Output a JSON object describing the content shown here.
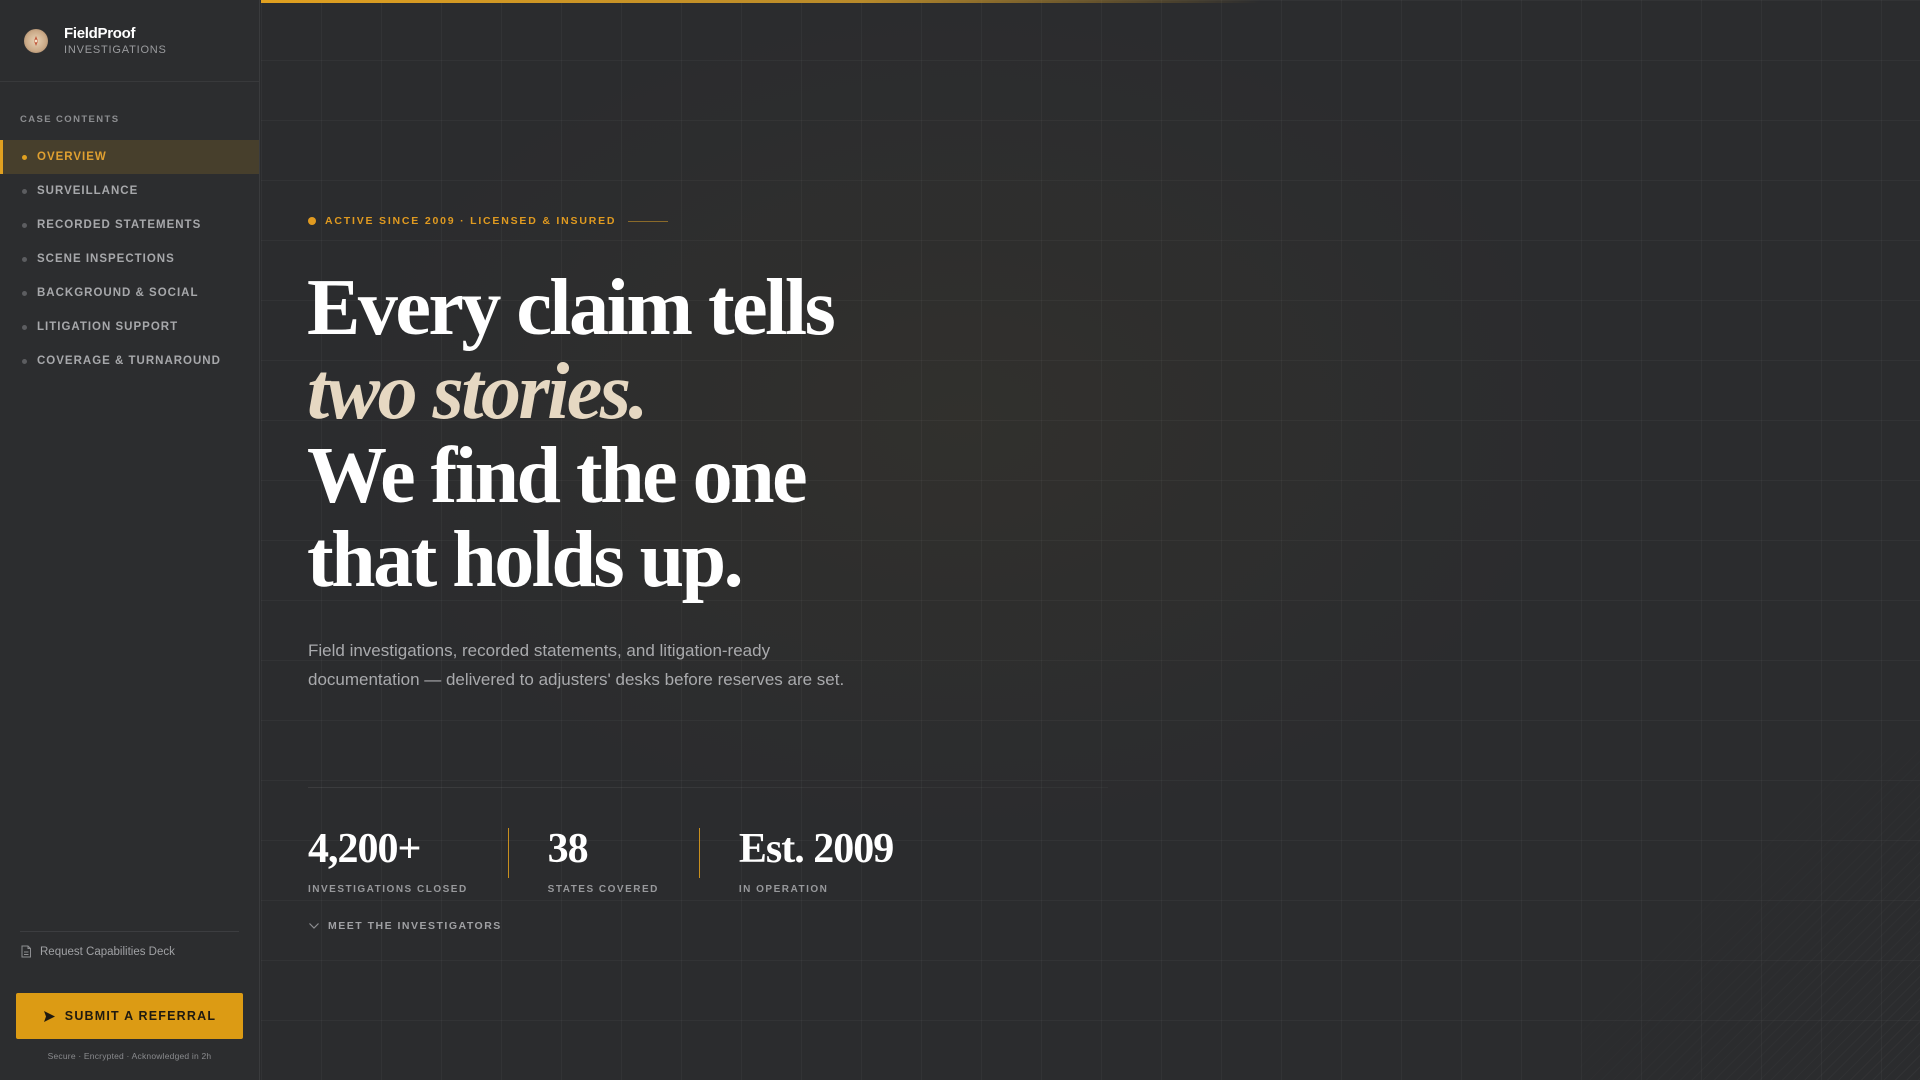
{
  "brand": {
    "name": "FieldProof",
    "subtitle": "INVESTIGATIONS",
    "logo_icon": "compass-badge-icon"
  },
  "sidebar": {
    "section_label": "CASE CONTENTS",
    "items": [
      {
        "label": "OVERVIEW",
        "active": true
      },
      {
        "label": "SURVEILLANCE",
        "active": false
      },
      {
        "label": "RECORDED STATEMENTS",
        "active": false
      },
      {
        "label": "SCENE INSPECTIONS",
        "active": false
      },
      {
        "label": "BACKGROUND & SOCIAL",
        "active": false
      },
      {
        "label": "LITIGATION SUPPORT",
        "active": false
      },
      {
        "label": "COVERAGE & TURNAROUND",
        "active": false
      }
    ],
    "deck_link": "Request Capabilities Deck",
    "referral_button": "SUBMIT A REFERRAL",
    "secure_note": "Secure · Encrypted · Acknowledged in 2h"
  },
  "hero": {
    "eyebrow": "ACTIVE SINCE 2009 · LICENSED & INSURED",
    "headline_line1": "Every claim tells",
    "headline_italic": "two stories.",
    "headline_line3": "We find the one",
    "headline_line4": "that holds up.",
    "lede": "Field investigations, recorded statements, and litigation-ready documentation — delivered to adjusters' desks before reserves are set."
  },
  "stats": [
    {
      "value": "4,200+",
      "label": "INVESTIGATIONS CLOSED"
    },
    {
      "value": "38",
      "label": "STATES COVERED"
    },
    {
      "value": "Est. 2009",
      "label": "IN OPERATION"
    }
  ],
  "meet_link": "MEET THE INVESTIGATORS",
  "colors": {
    "accent": "#dc9b14",
    "background": "#2b2c2e",
    "sidebar": "#2c2d2f",
    "headline_italic": "#e6d8c2"
  }
}
